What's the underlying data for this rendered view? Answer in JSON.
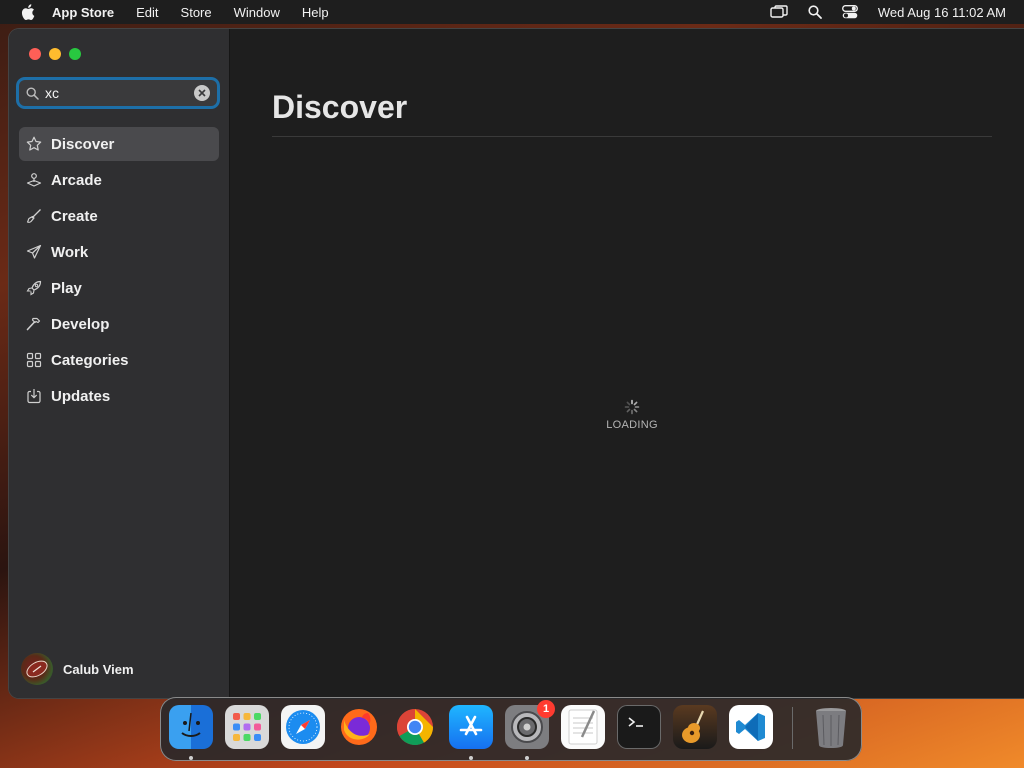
{
  "menubar": {
    "app_name": "App Store",
    "menus": [
      "Edit",
      "Store",
      "Window",
      "Help"
    ],
    "datetime": "Wed Aug 16  11:02 AM"
  },
  "search": {
    "value": "xc",
    "placeholder": "Search"
  },
  "sidebar": {
    "items": [
      {
        "label": "Discover",
        "icon": "star-icon",
        "active": true
      },
      {
        "label": "Arcade",
        "icon": "joystick-icon"
      },
      {
        "label": "Create",
        "icon": "brush-icon"
      },
      {
        "label": "Work",
        "icon": "paper-plane-icon"
      },
      {
        "label": "Play",
        "icon": "rocket-icon"
      },
      {
        "label": "Develop",
        "icon": "hammer-icon"
      },
      {
        "label": "Categories",
        "icon": "grid-icon"
      },
      {
        "label": "Updates",
        "icon": "download-icon"
      }
    ]
  },
  "user": {
    "name": "Calub Viem"
  },
  "main": {
    "title": "Discover",
    "loading_text": "LOADING"
  },
  "dock": {
    "apps": [
      "Finder",
      "Launchpad",
      "Safari",
      "Firefox",
      "Chrome",
      "App Store",
      "System Settings",
      "TextEdit",
      "Terminal",
      "GarageBand",
      "Visual Studio Code",
      "Trash"
    ],
    "system_settings_badge": "1"
  },
  "colors": {
    "focus_ring": "#1d6fa8",
    "sidebar_bg": "#2f2f31",
    "content_bg": "#1e1e1e",
    "badge": "#ff3b30"
  }
}
